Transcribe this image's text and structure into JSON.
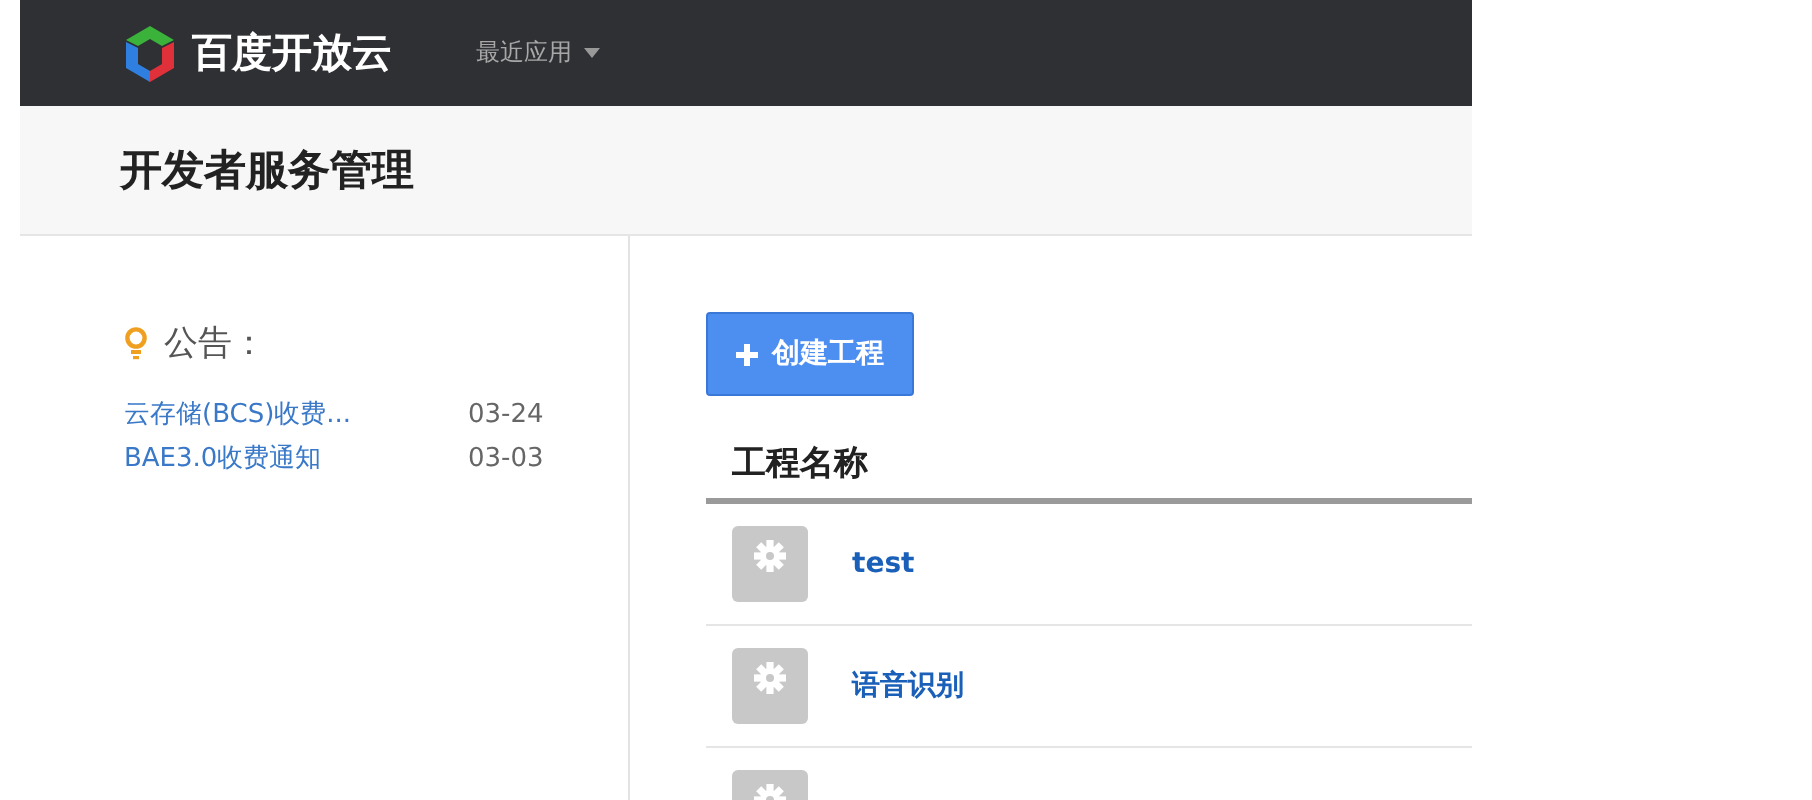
{
  "header": {
    "brand": "百度开放云",
    "menu": "最近应用"
  },
  "page_title": "开发者服务管理",
  "notices": {
    "title": "公告：",
    "items": [
      {
        "text": "云存储(BCS)收费...",
        "date": "03-24"
      },
      {
        "text": "BAE3.0收费通知",
        "date": "03-03"
      }
    ]
  },
  "create_button": "创建工程",
  "table": {
    "column": "工程名称",
    "rows": [
      {
        "name": "test"
      },
      {
        "name": "语音识别"
      },
      {
        "name": null
      }
    ]
  }
}
